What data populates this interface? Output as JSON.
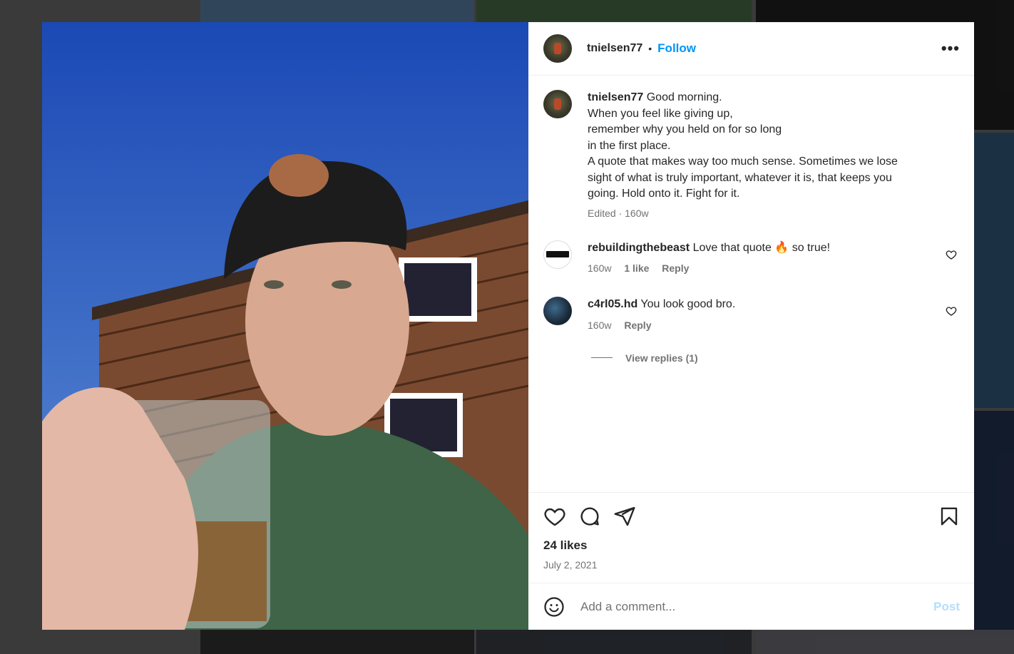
{
  "post": {
    "username": "tnielsen77",
    "follow_label": "Follow",
    "more_label": "•••",
    "caption_lines": [
      "Good morning.",
      "When you feel like giving up,",
      "remember why you held on for so long",
      "in the first place.",
      "A quote that makes way too much sense. Sometimes we lose",
      "sight of what is truly important, whatever it is, that keeps you",
      "going. Hold onto it. Fight for it."
    ],
    "caption_meta": "Edited · 160w",
    "likes": "24 likes",
    "date": "July 2, 2021"
  },
  "comments": [
    {
      "username": "rebuildingthebeast",
      "text": "Love that quote 🔥 so true!",
      "age": "160w",
      "likes": "1 like",
      "reply": "Reply"
    },
    {
      "username": "c4rl05.hd",
      "text": "You look good bro.",
      "age": "160w",
      "reply": "Reply"
    }
  ],
  "view_replies": "View replies (1)",
  "comment_box": {
    "placeholder": "Add a comment...",
    "post_label": "Post"
  },
  "icons": [
    "heart-icon",
    "comment-icon",
    "share-icon",
    "bookmark-icon",
    "emoji-icon",
    "more-icon"
  ],
  "colors": {
    "accent": "#0095f6",
    "post_disabled": "#b2dffc",
    "text": "#262626",
    "muted": "#737373"
  }
}
